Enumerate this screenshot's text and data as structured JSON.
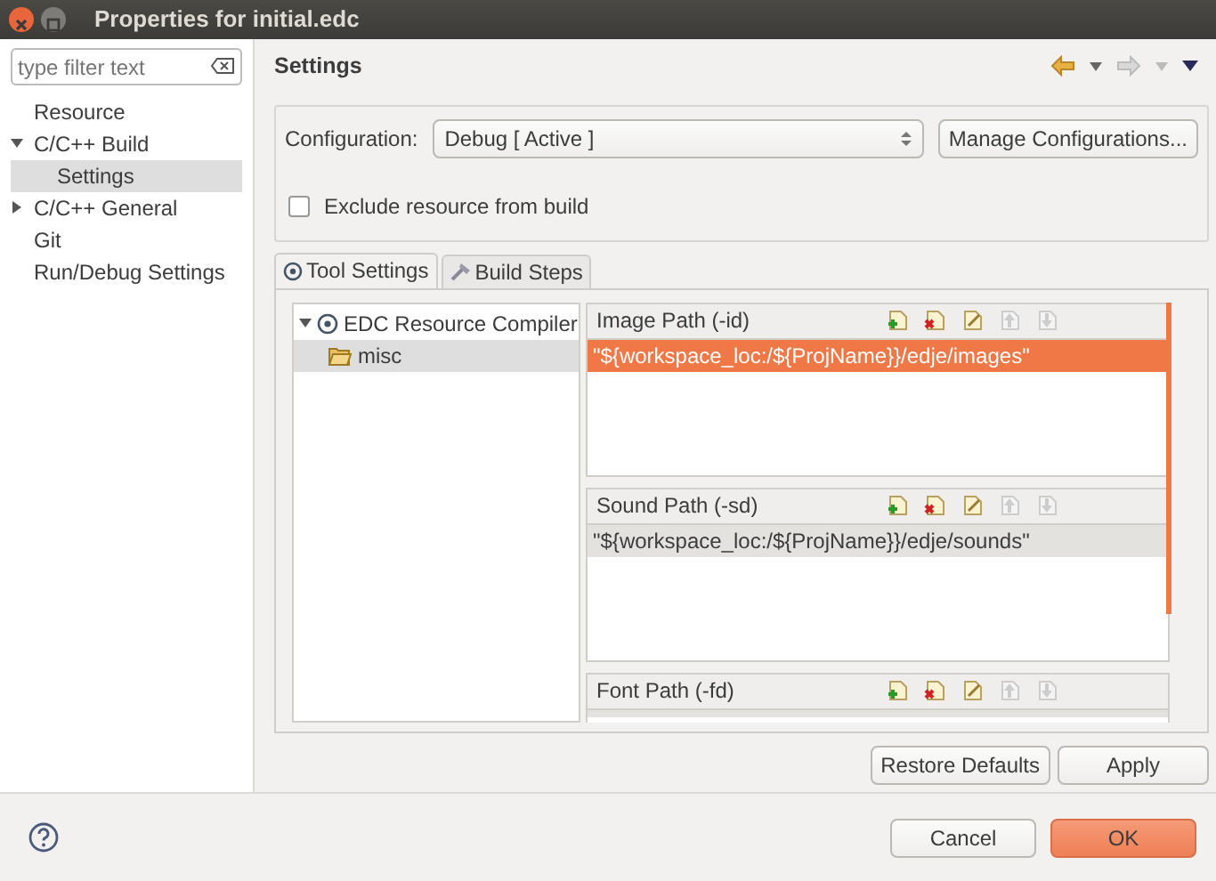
{
  "window": {
    "title": "Properties for initial.edc"
  },
  "filter": {
    "placeholder": "type filter text"
  },
  "sidebar": {
    "items": [
      {
        "label": "Resource",
        "selected": false
      },
      {
        "label": "C/C++ Build",
        "selected": false,
        "expanded": true,
        "children": [
          {
            "label": "Settings",
            "selected": true
          }
        ]
      },
      {
        "label": "C/C++ General",
        "selected": false,
        "expanded": false
      },
      {
        "label": "Git",
        "selected": false
      },
      {
        "label": "Run/Debug Settings",
        "selected": false
      }
    ]
  },
  "page": {
    "title": "Settings"
  },
  "configuration": {
    "label": "Configuration:",
    "value": "Debug  [ Active ]",
    "button": "Manage Configurations..."
  },
  "exclude": {
    "label": "Exclude resource from build",
    "checked": false
  },
  "tabs": [
    {
      "label": "Tool Settings",
      "selected": true
    },
    {
      "label": "Build Steps",
      "selected": false
    }
  ],
  "tool_tree": [
    {
      "label": "EDC Resource Compiler",
      "expanded": true,
      "selected": false,
      "children": [
        {
          "label": "misc",
          "selected": true
        }
      ]
    }
  ],
  "sections": [
    {
      "title": "Image Path (-id)",
      "rows": [
        {
          "text": "\"${workspace_loc:/${ProjName}}/edje/images\"",
          "selected": true
        }
      ]
    },
    {
      "title": "Sound Path (-sd)",
      "rows": [
        {
          "text": "\"${workspace_loc:/${ProjName}}/edje/sounds\"",
          "selected": false
        }
      ]
    },
    {
      "title": "Font Path (-fd)"
    }
  ],
  "section_tools": [
    {
      "kind": "add",
      "disabled": false
    },
    {
      "kind": "delete",
      "disabled": false
    },
    {
      "kind": "edit",
      "disabled": false
    },
    {
      "kind": "up",
      "disabled": true
    },
    {
      "kind": "down",
      "disabled": true
    }
  ],
  "nav": [
    {
      "kind": "back",
      "disabled": false
    },
    {
      "kind": "forward",
      "disabled": true
    }
  ],
  "page_buttons": [
    "Restore Defaults",
    "Apply"
  ],
  "dialog_buttons": [
    {
      "label": "Cancel",
      "primary": false
    },
    {
      "label": "OK",
      "primary": true
    }
  ]
}
